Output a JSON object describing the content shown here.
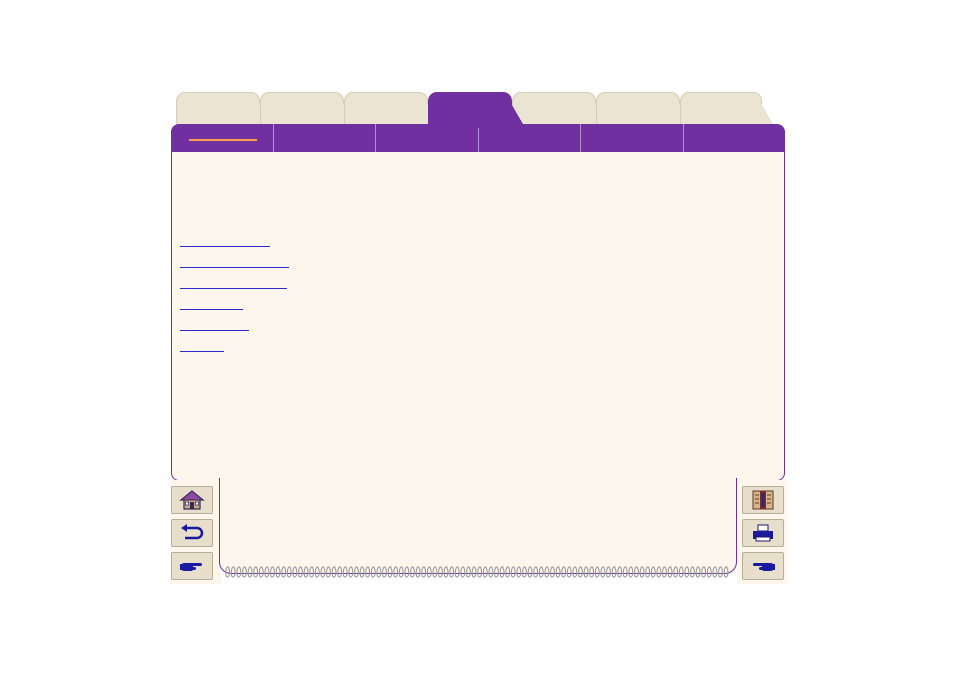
{
  "top_tabs": [
    {
      "label": ""
    },
    {
      "label": ""
    },
    {
      "label": ""
    },
    {
      "label": "",
      "active": true
    },
    {
      "label": ""
    },
    {
      "label": ""
    },
    {
      "label": ""
    }
  ],
  "sub_tabs": [
    {
      "label": "",
      "selected": true
    },
    {
      "label": ""
    },
    {
      "label": ""
    },
    {
      "label": ""
    },
    {
      "label": ""
    },
    {
      "label": ""
    }
  ],
  "links": [
    {
      "label": ""
    },
    {
      "label": ""
    },
    {
      "label": ""
    },
    {
      "label": ""
    },
    {
      "label": ""
    },
    {
      "label": ""
    }
  ],
  "nav_left": [
    {
      "icon": "home-icon"
    },
    {
      "icon": "back-arrow-icon"
    },
    {
      "icon": "pointing-hand-right-icon"
    }
  ],
  "nav_right": [
    {
      "icon": "contents-book-icon"
    },
    {
      "icon": "printer-icon"
    },
    {
      "icon": "pointing-hand-left-icon"
    }
  ],
  "colors": {
    "accent_purple": "#7030a0",
    "panel_background": "#fcf6ec",
    "inactive_tab": "#ebe4d3",
    "selected_underline": "#f5a050",
    "link": "#0000cc"
  }
}
